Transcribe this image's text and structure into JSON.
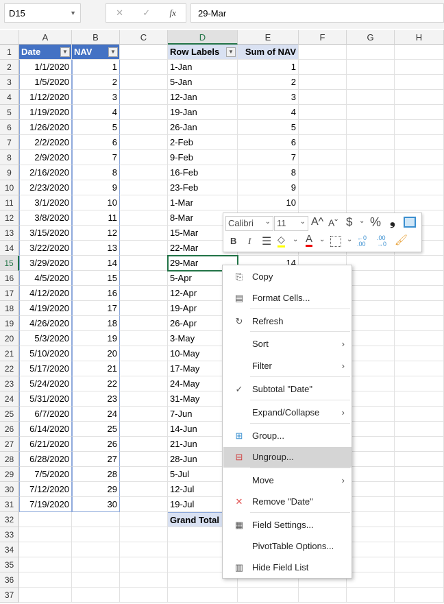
{
  "formula_bar": {
    "name_box": "D15",
    "formula": "29-Mar",
    "cancel_icon": "✕",
    "enter_icon": "✓",
    "fx_label": "fx"
  },
  "columns": [
    "A",
    "B",
    "C",
    "D",
    "E",
    "F",
    "G",
    "H"
  ],
  "table": {
    "headers": [
      "Date",
      "NAV"
    ],
    "dates": [
      "1/1/2020",
      "1/5/2020",
      "1/12/2020",
      "1/19/2020",
      "1/26/2020",
      "2/2/2020",
      "2/9/2020",
      "2/16/2020",
      "2/23/2020",
      "3/1/2020",
      "3/8/2020",
      "3/15/2020",
      "3/22/2020",
      "3/29/2020",
      "4/5/2020",
      "4/12/2020",
      "4/19/2020",
      "4/26/2020",
      "5/3/2020",
      "5/10/2020",
      "5/17/2020",
      "5/24/2020",
      "5/31/2020",
      "6/7/2020",
      "6/14/2020",
      "6/21/2020",
      "6/28/2020",
      "7/5/2020",
      "7/12/2020",
      "7/19/2020"
    ],
    "nav": [
      "1",
      "2",
      "3",
      "4",
      "5",
      "6",
      "7",
      "8",
      "9",
      "10",
      "11",
      "12",
      "13",
      "14",
      "15",
      "16",
      "17",
      "18",
      "19",
      "20",
      "21",
      "22",
      "23",
      "24",
      "25",
      "26",
      "27",
      "28",
      "29",
      "30"
    ]
  },
  "pivot": {
    "headers": [
      "Row Labels",
      "Sum of NAV"
    ],
    "labels": [
      "1-Jan",
      "5-Jan",
      "12-Jan",
      "19-Jan",
      "26-Jan",
      "2-Feb",
      "9-Feb",
      "16-Feb",
      "23-Feb",
      "1-Mar",
      "8-Mar",
      "15-Mar",
      "22-Mar",
      "29-Mar",
      "5-Apr",
      "12-Apr",
      "19-Apr",
      "26-Apr",
      "3-May",
      "10-May",
      "17-May",
      "24-May",
      "31-May",
      "7-Jun",
      "14-Jun",
      "21-Jun",
      "28-Jun",
      "5-Jul",
      "12-Jul",
      "19-Jul"
    ],
    "values": [
      "1",
      "2",
      "3",
      "4",
      "5",
      "6",
      "7",
      "8",
      "9",
      "10",
      "",
      "",
      "",
      "14"
    ],
    "grand_total": "Grand Total"
  },
  "mini_toolbar": {
    "font": "Calibri",
    "size": "11",
    "grow": "A^",
    "shrink": "Aˇ",
    "currency": "$",
    "percent": "%",
    "comma": "❟",
    "bold": "B",
    "italic": "I",
    "fill_color": "#FFFF00",
    "font_color": "#FF0000"
  },
  "context_menu": [
    {
      "label": "Copy",
      "icon": "copy-icon",
      "glyph": "⎘"
    },
    {
      "label": "Format Cells...",
      "icon": "format-cells-icon",
      "glyph": "▤"
    },
    {
      "label": "Refresh",
      "icon": "refresh-icon",
      "glyph": "↻"
    },
    {
      "label": "Sort",
      "arrow": "›"
    },
    {
      "label": "Filter",
      "arrow": "›"
    },
    {
      "label": "Subtotal \"Date\"",
      "icon": "check-icon",
      "glyph": "✓"
    },
    {
      "label": "Expand/Collapse",
      "arrow": "›"
    },
    {
      "label": "Group...",
      "icon": "group-icon",
      "glyph": "⊞"
    },
    {
      "label": "Ungroup...",
      "icon": "ungroup-icon",
      "glyph": "⊟"
    },
    {
      "label": "Move",
      "arrow": "›"
    },
    {
      "label": "Remove \"Date\"",
      "icon": "remove-icon",
      "glyph": "✕"
    },
    {
      "label": "Field Settings...",
      "icon": "field-settings-icon",
      "glyph": "▦"
    },
    {
      "label": "PivotTable Options..."
    },
    {
      "label": "Hide Field List",
      "icon": "field-list-icon",
      "glyph": "▥"
    }
  ]
}
